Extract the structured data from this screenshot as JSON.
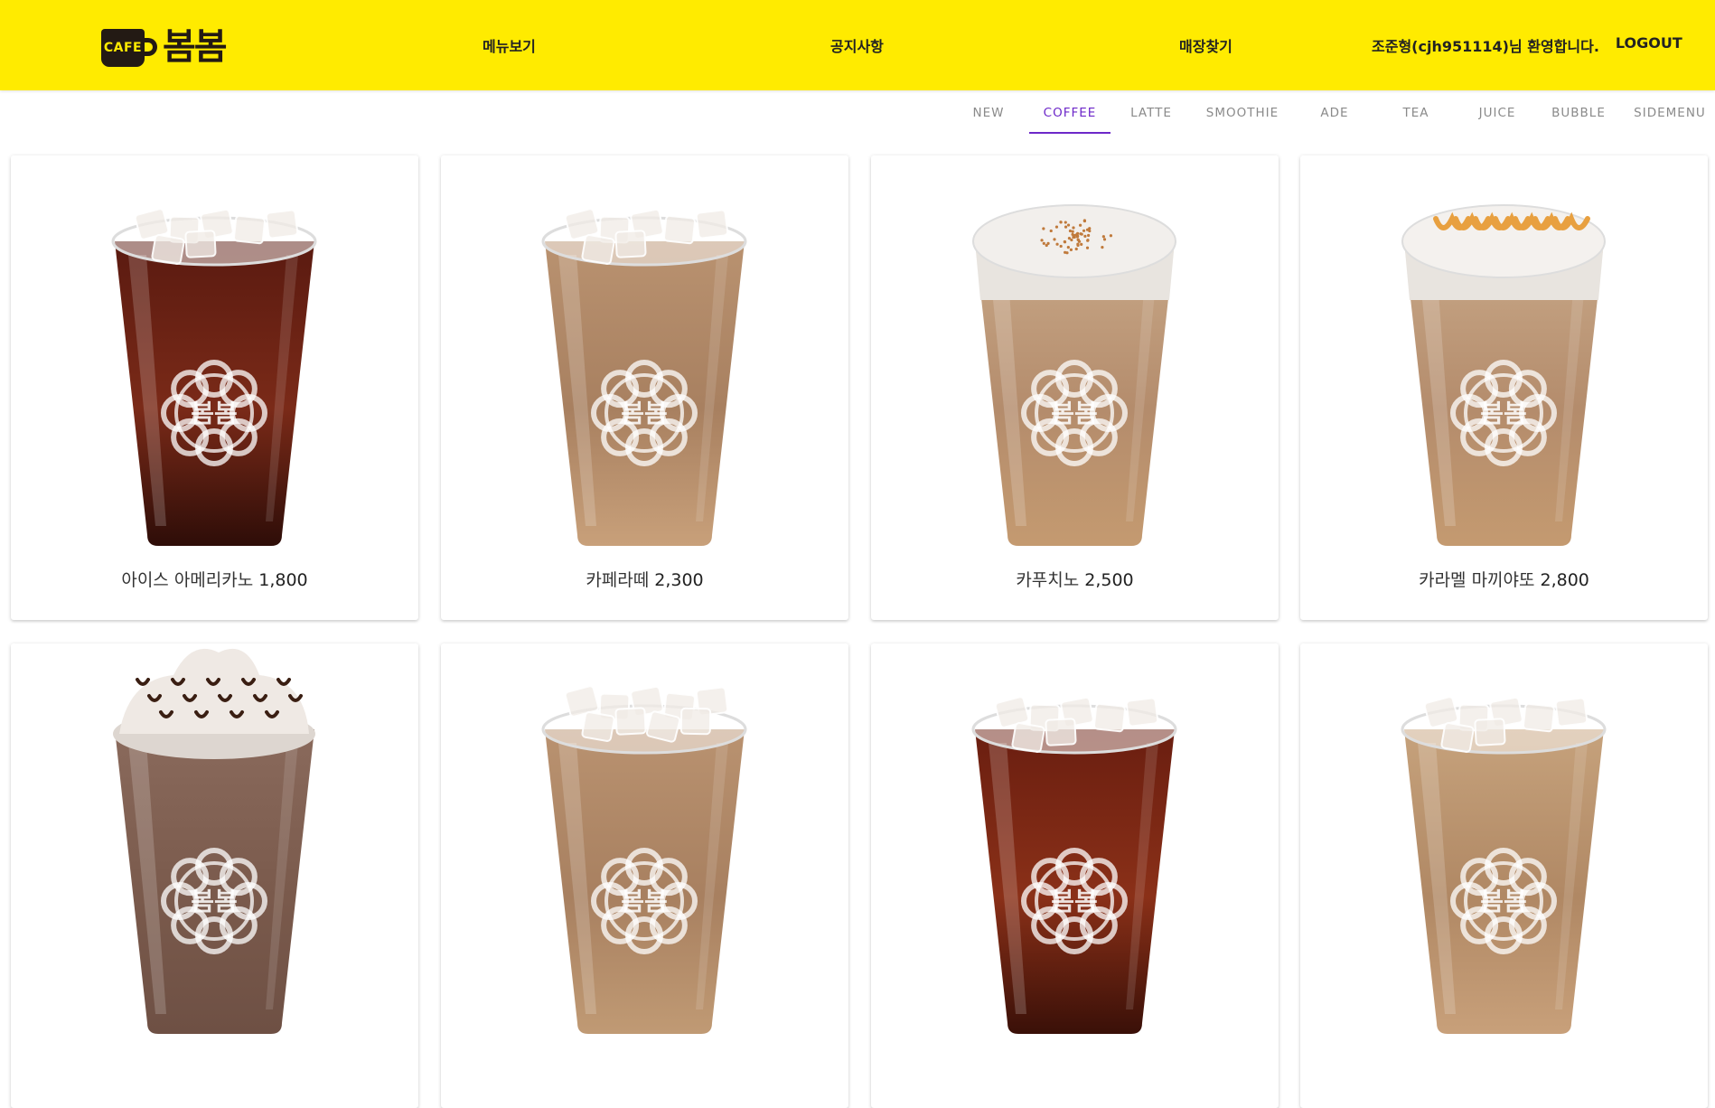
{
  "logo": {
    "badge": "CAFE",
    "name": "봄봄"
  },
  "nav": {
    "menu": "메뉴보기",
    "notice": "공지사항",
    "store": "매장찾기"
  },
  "user": {
    "welcome": "조준형(cjh951114)님 환영합니다.",
    "logout": "LOGOUT"
  },
  "categories": [
    "NEW",
    "COFFEE",
    "LATTE",
    "SMOOTHIE",
    "ADE",
    "TEA",
    "JUICE",
    "BUBBLE",
    "SIDEMENU"
  ],
  "active_category": "COFFEE",
  "products": [
    {
      "name": "아이스 아메리카노",
      "price": "1,800",
      "kind": "americano"
    },
    {
      "name": "카페라떼",
      "price": "2,300",
      "kind": "latte"
    },
    {
      "name": "카푸치노",
      "price": "2,500",
      "kind": "cappuccino"
    },
    {
      "name": "카라멜 마끼야또",
      "price": "2,800",
      "kind": "macchiato"
    },
    {
      "name": "",
      "price": "",
      "kind": "mocha"
    },
    {
      "name": "",
      "price": "",
      "kind": "latte-ice"
    },
    {
      "name": "",
      "price": "",
      "kind": "coldbrew"
    },
    {
      "name": "",
      "price": "",
      "kind": "vanilla-latte"
    }
  ],
  "colors": {
    "header": "#ffeb00",
    "accent": "#6d28c9",
    "americano": "#6b1f12",
    "latte": "#c49a74",
    "cup_logo": "봄봄"
  }
}
